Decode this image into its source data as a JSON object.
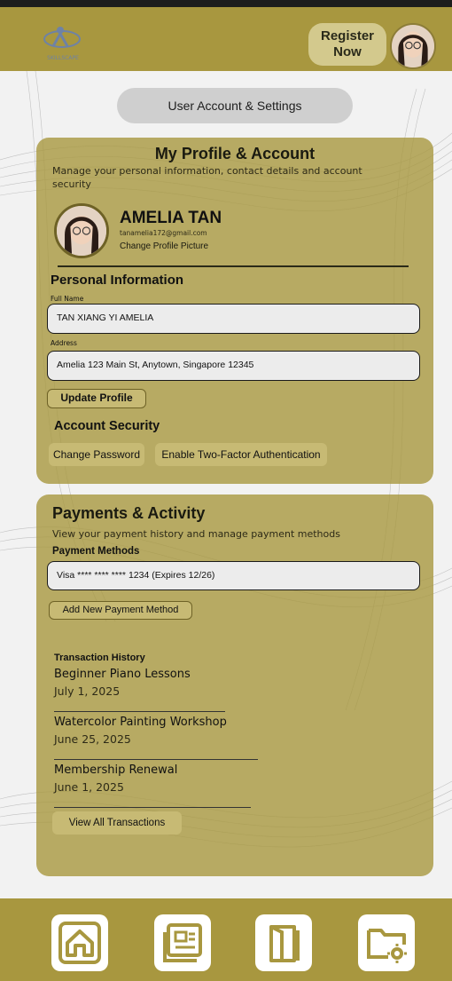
{
  "header": {
    "register_label": "Register\nNow",
    "logo_text": "SKILLSCAPE"
  },
  "page_tab": "User Account & Settings",
  "profile_card": {
    "title": "My Profile & Account",
    "subtitle": "Manage your personal information, contact details and account security",
    "name": "AMELIA TAN",
    "email": "tanamelia172@gmail.com",
    "change_picture": "Change Profile Picture",
    "personal_info_heading": "Personal Information",
    "full_name_label": "Full Name",
    "full_name_value": "TAN XIANG YI AMELIA",
    "address_label": "Address",
    "address_value": "Amelia 123 Main St, Anytown, Singapore 12345",
    "update_button": "Update Profile",
    "security_heading": "Account Security",
    "change_password": "Change Password",
    "two_factor": "Enable Two-Factor Authentication"
  },
  "payments_card": {
    "title": "Payments & Activity",
    "subtitle": "View your payment history and manage payment methods",
    "methods_heading": "Payment Methods",
    "card_value": "Visa **** **** **** 1234 (Expires 12/26)",
    "add_method": "Add New Payment Method",
    "history_heading": "Transaction History",
    "transactions": [
      {
        "name": "Beginner Piano Lessons",
        "date": "July 1, 2025"
      },
      {
        "name": "Watercolor Painting Workshop",
        "date": "June 25, 2025"
      },
      {
        "name": "Membership Renewal",
        "date": "June 1, 2025"
      }
    ],
    "view_all": "View All Transactions"
  },
  "bottom_nav": {
    "icons": [
      "home-icon",
      "news-icon",
      "book-icon",
      "folder-settings-icon"
    ]
  },
  "colors": {
    "brand_gold": "#a8973f",
    "card_gold": "#b3a55e",
    "chip": "#c7ba74",
    "field_bg": "#ececec"
  }
}
